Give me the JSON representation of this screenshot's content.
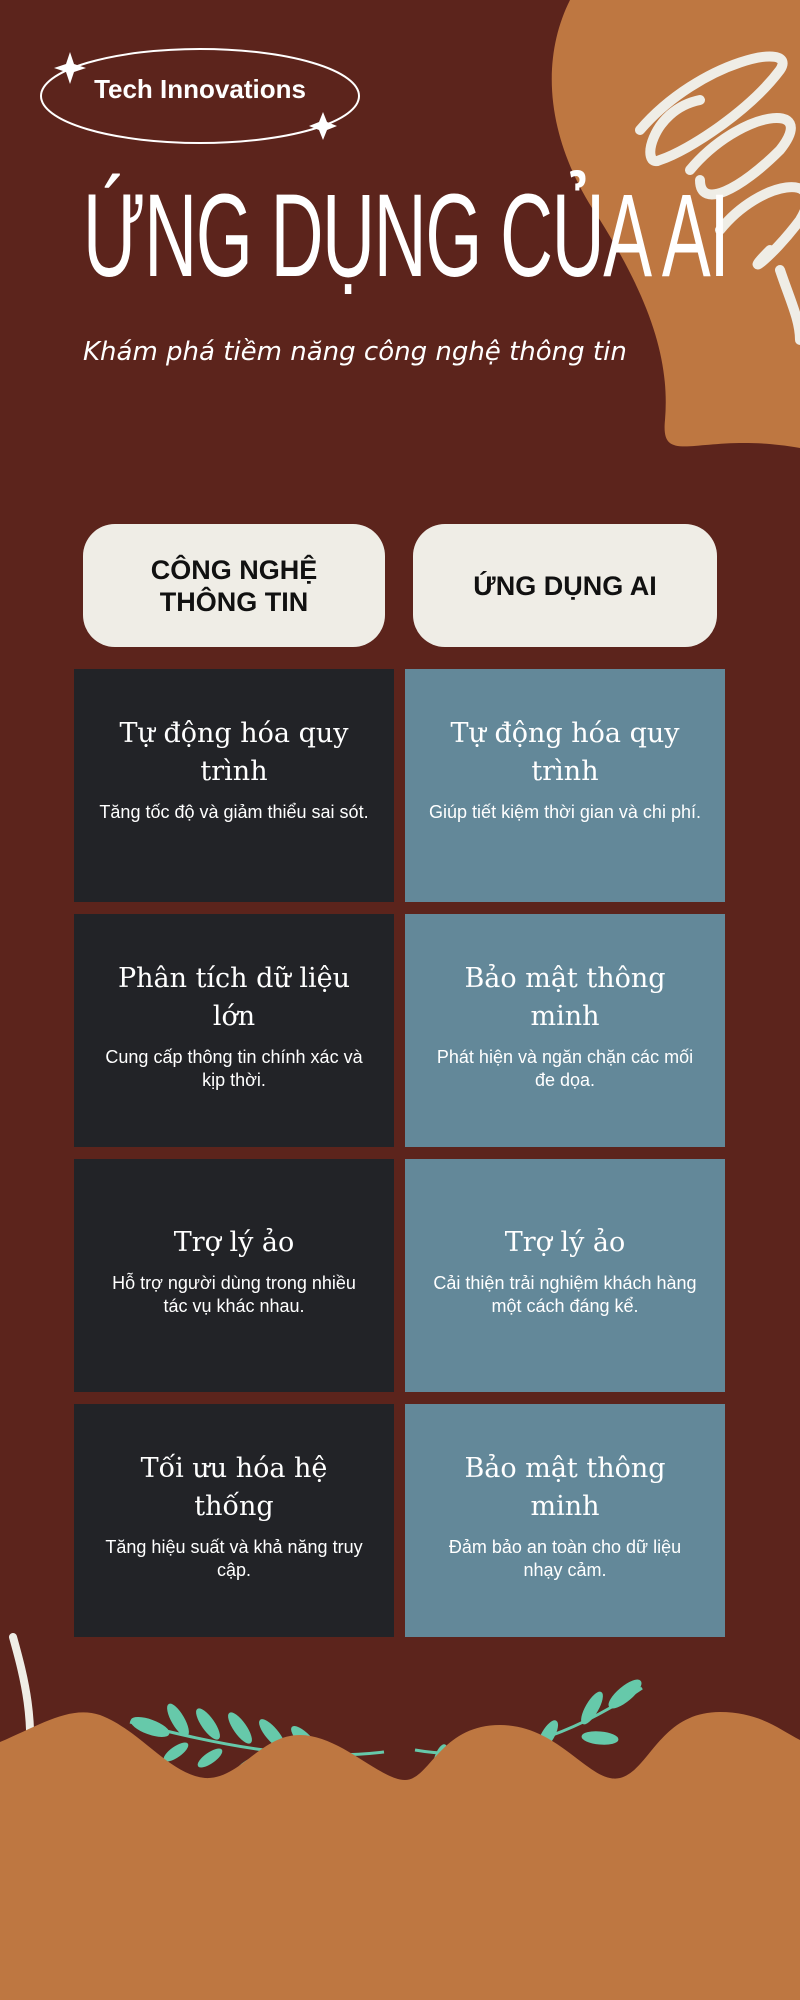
{
  "badge": "Tech Innovations",
  "title": "ỨNG DỤNG CỦA AI",
  "subtitle": "Khám phá tiềm năng công nghệ thông tin",
  "columns": [
    "CÔNG NGHỆ THÔNG TIN",
    "ỨNG DỤNG AI"
  ],
  "rows": [
    {
      "left": {
        "title": "Tự động hóa quy trình",
        "text": "Tăng tốc độ và giảm thiểu sai sót."
      },
      "right": {
        "title": "Tự động hóa quy trình",
        "text": "Giúp tiết kiệm thời gian và chi phí."
      }
    },
    {
      "left": {
        "title": "Phân tích dữ liệu lớn",
        "text": "Cung cấp thông tin chính xác và kịp thời."
      },
      "right": {
        "title": "Bảo mật thông minh",
        "text": "Phát hiện và ngăn chặn các mối đe dọa."
      }
    },
    {
      "left": {
        "title": "Trợ lý ảo",
        "text": "Hỗ trợ người dùng trong nhiều tác vụ khác nhau."
      },
      "right": {
        "title": "Trợ lý ảo",
        "text": "Cải thiện trải nghiệm khách hàng một cách đáng kể."
      }
    },
    {
      "left": {
        "title": "Tối ưu hóa hệ thống",
        "text": "Tăng hiệu suất và khả năng truy cập."
      },
      "right": {
        "title": "Bảo mật thông minh",
        "text": "Đảm bảo an toàn cho dữ liệu nhạy cảm."
      }
    }
  ],
  "colors": {
    "background": "#5c241c",
    "orange": "#be7741",
    "cream": "#efede6",
    "dark_card": "#222327",
    "blue_card": "#638899",
    "leaf": "#66c9aa"
  }
}
